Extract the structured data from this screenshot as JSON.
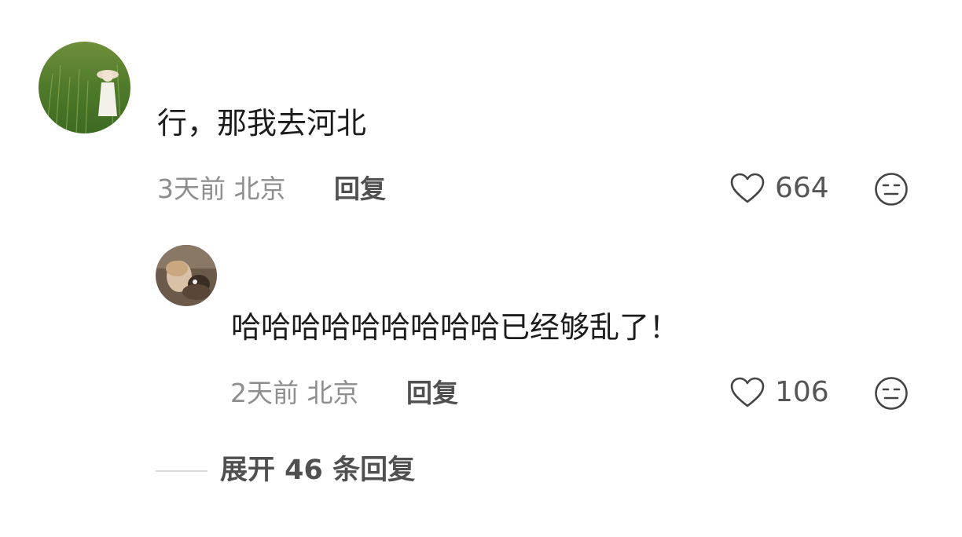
{
  "comment": {
    "text": "行，那我去河北",
    "meta": "3天前 北京",
    "reply_label": "回复",
    "likes": "664",
    "like_icon": "heart-outline-icon",
    "dislike_icon": "meh-face-icon"
  },
  "reply": {
    "text": "哈哈哈哈哈哈哈哈哈已经够乱了！",
    "meta": "2天前 北京",
    "reply_label": "回复",
    "likes": "106",
    "like_icon": "heart-outline-icon",
    "dislike_icon": "meh-face-icon"
  },
  "expand": {
    "label": "展开 46 条回复"
  },
  "colors": {
    "text_primary": "#1c1c1c",
    "text_meta": "#8e8e8e",
    "text_action": "#505050",
    "divider": "#dadada"
  }
}
